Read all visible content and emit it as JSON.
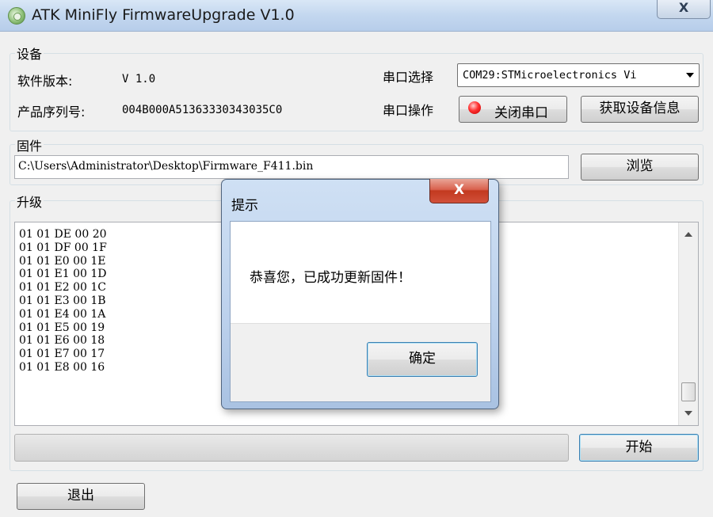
{
  "window": {
    "title": "ATK MiniFly FirmwareUpgrade V1.0",
    "close_glyph": "X",
    "app_icon": "gear-refresh-icon"
  },
  "device": {
    "group_label": "设备",
    "software_version_label": "软件版本:",
    "software_version_value": "V 1.0",
    "serial_label": "产品序列号:",
    "serial_value": "004B000A51363330343035C0",
    "port_select_label": "串口选择",
    "port_selected": "COM29:STMicroelectronics Vi",
    "port_op_label": "串口操作",
    "close_port_button": "关闭串口",
    "get_info_button": "获取设备信息"
  },
  "firmware": {
    "group_label": "固件",
    "path": "C:\\Users\\Administrator\\Desktop\\Firmware_F411.bin",
    "browse_button": "浏览"
  },
  "upgrade": {
    "group_label": "升级",
    "log_lines": [
      "01 01 DE 00 20",
      "01 01 DF 00 1F",
      "01 01 E0 00 1E",
      "01 01 E1 00 1D",
      "01 01 E2 00 1C",
      "01 01 E3 00 1B",
      "01 01 E4 00 1A",
      "01 01 E5 00 19",
      "01 01 E6 00 18",
      "01 01 E7 00 17",
      "01 01 E8 00 16"
    ],
    "start_button": "开始",
    "progress": 0
  },
  "footer": {
    "exit_button": "退出"
  },
  "dialog": {
    "title": "提示",
    "close_glyph": "X",
    "message": "恭喜您，已成功更新固件！",
    "ok_button": "确定"
  }
}
